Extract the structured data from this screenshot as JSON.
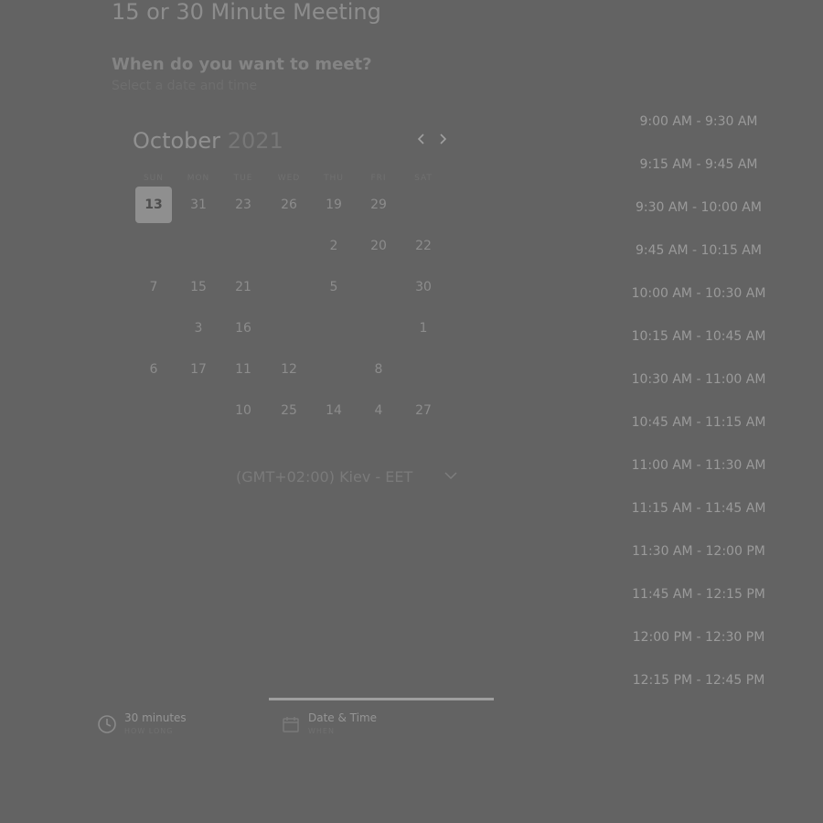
{
  "page": {
    "title": "15 or 30 Minute Meeting",
    "question": "When do you want to meet?",
    "subtitle": "Select a date and time"
  },
  "calendar": {
    "month": "October",
    "year": "2021",
    "prev_icon": "chevron-left-icon",
    "next_icon": "chevron-right-icon",
    "weekdays": [
      "SUN",
      "MON",
      "TUE",
      "WED",
      "THU",
      "FRI",
      "SAT"
    ],
    "selected_day": "13",
    "days": [
      "13",
      "31",
      "23",
      "26",
      "19",
      "29",
      "2",
      "20",
      "22",
      "7",
      "15",
      "21",
      "5",
      "30",
      "3",
      "16",
      "1",
      "6",
      "17",
      "11",
      "12",
      "8",
      "10",
      "25",
      "14",
      "4",
      "27"
    ]
  },
  "timezone": {
    "label": "(GMT+02:00) Kiev - EET",
    "icon": "chevron-down-icon"
  },
  "time_slots": [
    "9:00 AM - 9:30 AM",
    "9:15 AM - 9:45 AM",
    "9:30 AM - 10:00 AM",
    "9:45 AM - 10:15 AM",
    "10:00 AM - 10:30 AM",
    "10:15 AM - 10:45 AM",
    "10:30 AM - 11:00 AM",
    "10:45 AM - 11:15 AM",
    "11:00 AM - 11:30 AM",
    "11:15 AM - 11:45 AM",
    "11:30 AM - 12:00 PM",
    "11:45 AM - 12:15 PM",
    "12:00 PM - 12:30 PM",
    "12:15 PM - 12:45 PM"
  ],
  "steps": [
    {
      "label": "30 minutes",
      "sub": "HOW LONG",
      "icon": "clock-icon"
    },
    {
      "label": "Date & Time",
      "sub": "WHEN",
      "icon": "calendar-icon"
    }
  ]
}
